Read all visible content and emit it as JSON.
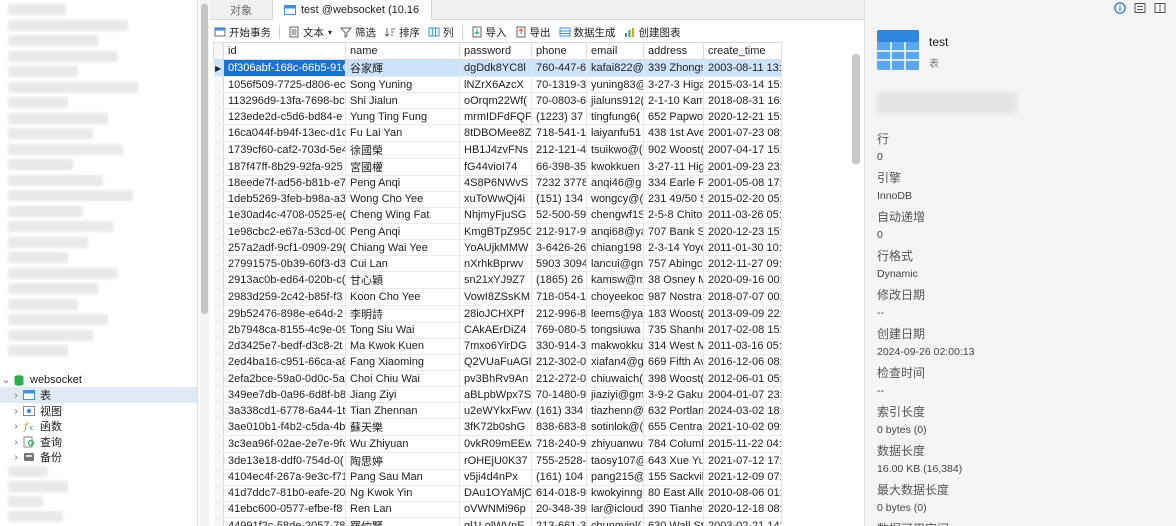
{
  "tabs": [
    {
      "label": "对象"
    },
    {
      "label": "test @websocket (10.16"
    }
  ],
  "toolbar": {
    "begin_tx": "开始事务",
    "text": "文本",
    "filter": "筛选",
    "sort": "排序",
    "columns": "列",
    "import": "导入",
    "export": "导出",
    "data_gen": "数据生成",
    "create_chart": "创建图表"
  },
  "sidebar": {
    "db_name": "websocket",
    "children": [
      {
        "label": "表"
      },
      {
        "label": "视图"
      },
      {
        "label": "函数"
      },
      {
        "label": "查询"
      },
      {
        "label": "备份"
      }
    ]
  },
  "grid": {
    "columns": [
      "id",
      "name",
      "password",
      "phone",
      "email",
      "address",
      "create_time"
    ],
    "rows": [
      [
        "0f306abf-168c-66b5-91€",
        "谷家輝",
        "dgDdk8YC8l",
        "760-447-6",
        "kafai822@",
        "339 Zhongs",
        "2003-08-11 13:"
      ],
      [
        "1056f509-7725-d806-ec",
        "Song Yuning",
        "lNZrX6AzcX",
        "70-1319-3",
        "yuning83@",
        "3-27-3 Higa",
        "2015-03-14 15:"
      ],
      [
        "113296d9-13fa-7698-bc",
        "Shi Jialun",
        "oOrqm22Wf(",
        "70-0803-6",
        "jialuns912(",
        "2-1-10 Kam",
        "2018-08-31 16:"
      ],
      [
        "123ede2d-c5d6-bd84-e",
        "Yung Ting Fung",
        "mrmIDFdFQF",
        "(1223) 37 4",
        "tingfung6(",
        "652 Papwo",
        "2020-12-21 15:"
      ],
      [
        "16ca044f-b94f-13ec-d1c",
        "Fu Lai Yan",
        "8tDBOMee8Z",
        "718-541-1",
        "laiyanfu51",
        "438 1st Ave",
        "2001-07-23 08:"
      ],
      [
        "1739cf60-caf2-703d-5e4",
        "徐國榮",
        "HB1J4zvFNs",
        "212-121-4",
        "tsuikwo@(",
        "902 Woost(",
        "2007-04-17 15:"
      ],
      [
        "187f47ff-8b29-92fa-925",
        "宮國權",
        "fG44vioI74",
        "66-398-35",
        "kwokkuen",
        "3-27-11 Hig",
        "2001-09-23 23:"
      ],
      [
        "18eede7f-ad56-b81b-e7",
        "Peng Anqi",
        "4S8P6NWvS",
        "7232 3778",
        "anqi46@g",
        "334 Earle R",
        "2001-05-08 17:"
      ],
      [
        "1deb5269-3feb-b98a-a3",
        "Wong Cho Yee",
        "xuToWwQj4i",
        "(151) 134 '",
        "wongcy@(",
        "231 49/50 S",
        "2015-02-20 05:"
      ],
      [
        "1e30ad4c-4708-0525-e(",
        "Cheng Wing Fat",
        "NhjmyFjuSG",
        "52-500-59",
        "chengwf1S",
        "2-5-8 Chito",
        "2011-03-26 05:"
      ],
      [
        "1e98cbc2-e67a-53cd-00",
        "Peng Anqi",
        "KmgBTpZ95C",
        "212-917-9",
        "anqi68@ya",
        "707 Bank St",
        "2020-12-23 15:"
      ],
      [
        "257a2adf-9cf1-0909-29(",
        "Chiang Wai Yee",
        "YoAUjkMMW",
        "3-6426-26",
        "chiang198",
        "2-3-14 Yoyo",
        "2011-01-30 10:"
      ],
      [
        "27991575-0b39-60f3-d3",
        "Cui Lan",
        "nXrhkBprwv",
        "5903 3094",
        "lancui@gn",
        "757 Abingc",
        "2012-11-27 09:"
      ],
      [
        "2913ac0b-ed64-020b-c(",
        "甘心穎",
        "sn21xYJ9Z7",
        "(1865) 26 4",
        "kamsw@m",
        "38 Osney M",
        "2020-09-16 00:"
      ],
      [
        "2983d259-2c42-b85f-f3",
        "Koon Cho Yee",
        "VowI8ZSsKM",
        "718-054-1",
        "choyeekoo",
        "987 Nostra",
        "2018-07-07 00:"
      ],
      [
        "29b52476-898e-e64d-2",
        "李明詩",
        "28ioJCHXPf",
        "212-996-8",
        "leems@ya",
        "183 Woost(",
        "2013-09-09 22:"
      ],
      [
        "2b7948ca-8155-4c9e-09",
        "Tong Siu Wai",
        "CAkAErDiZ4",
        "769-080-5",
        "tongsiuwa",
        "735 Shanhu",
        "2017-02-08 15:"
      ],
      [
        "2d3425e7-bedf-d3c8-2t",
        "Ma Kwok Kuen",
        "7mxo6YirDG",
        "330-914-3",
        "makwokku",
        "314 West M",
        "2011-03-16 05:"
      ],
      [
        "2ed4ba16-c951-66ca-a8",
        "Fang Xiaoming",
        "Q2VUaFuAGl",
        "212-302-0",
        "xiafan4@g",
        "669 Fifth Av",
        "2016-12-06 08:"
      ],
      [
        "2efa2bce-59a0-0d0c-5a",
        "Choi Chiu Wai",
        "pv3BhRv9An",
        "212-272-0",
        "chiuwaich(",
        "398 Woost(",
        "2012-06-01 05:"
      ],
      [
        "349ee7db-0a96-6d8f-b8",
        "Jiang Ziyi",
        "aBLpbWpx7S",
        "70-1480-9",
        "jiaziyi@gm",
        "3-9-2 Gaku",
        "2004-01-07 23:"
      ],
      [
        "3a338cd1-6778-6a44-1t",
        "Tian Zhennan",
        "u2eWYkxFwv",
        "(161) 334 .",
        "tiazhenn@",
        "632 Portlan",
        "2024-03-02 18:"
      ],
      [
        "3ae010b1-f4b2-c5da-4b",
        "蘇天樂",
        "3fK72b0shG",
        "838-683-8",
        "sotinlok@(",
        "655 Centra",
        "2021-10-02 09:"
      ],
      [
        "3c3ea96f-02ae-2e7e-9fc",
        "Wu Zhiyuan",
        "0vkR09mEEw",
        "718-240-9",
        "zhiyuanwu",
        "784 Columl",
        "2015-11-22 04:"
      ],
      [
        "3de13e18-ddf0-754d-0(",
        "陶思婷",
        "rOHEjU0K37",
        "755-2528-",
        "taosy107@",
        "643 Xue Yu",
        "2021-07-12 17:"
      ],
      [
        "4104ec4f-267a-9e3c-f71",
        "Pang Sau Man",
        "v5ji4d4nPx",
        "(161) 104 .",
        "pang215@",
        "155 Sackvil",
        "2021-12-09 07:"
      ],
      [
        "41d7ddc7-81b0-eafe-20",
        "Ng Kwok Yin",
        "DAu1OYaMjC",
        "614-018-9",
        "kwokyinng",
        "80 East Alle",
        "2010-08-06 01:"
      ],
      [
        "41ebc600-0577-efbe-f8",
        "Ren Lan",
        "oVWNMi96p",
        "20-348-39",
        "lar@icloud",
        "390 Tianhe",
        "2020-12-18 08:"
      ],
      [
        "44991f2c-58de-2057-78",
        "羅仲賢",
        "gl1LolWVnE",
        "213-661-3",
        "chungyinl(",
        "630 Wall St",
        "2003-02-21 14:"
      ]
    ]
  },
  "right_panel": {
    "title": "test",
    "subtitle": "表",
    "props": [
      {
        "k": "行",
        "v": "0"
      },
      {
        "k": "引擎",
        "v": "InnoDB"
      },
      {
        "k": "自动递增",
        "v": "0"
      },
      {
        "k": "行格式",
        "v": "Dynamic"
      },
      {
        "k": "修改日期",
        "v": "--"
      },
      {
        "k": "创建日期",
        "v": "2024-09-26 02:00:13"
      },
      {
        "k": "检查时间",
        "v": "--"
      },
      {
        "k": "索引长度",
        "v": "0 bytes (0)"
      },
      {
        "k": "数据长度",
        "v": "16.00 KB (16,384)"
      },
      {
        "k": "最大数据长度",
        "v": "0 bytes (0)"
      },
      {
        "k": "数据可用空间",
        "v": ""
      }
    ]
  },
  "colors": {
    "selection": "#1a73d0",
    "row_selection": "#cde3f9",
    "db_green": "#2fae4f",
    "table_blue": "#3d8fe0"
  }
}
